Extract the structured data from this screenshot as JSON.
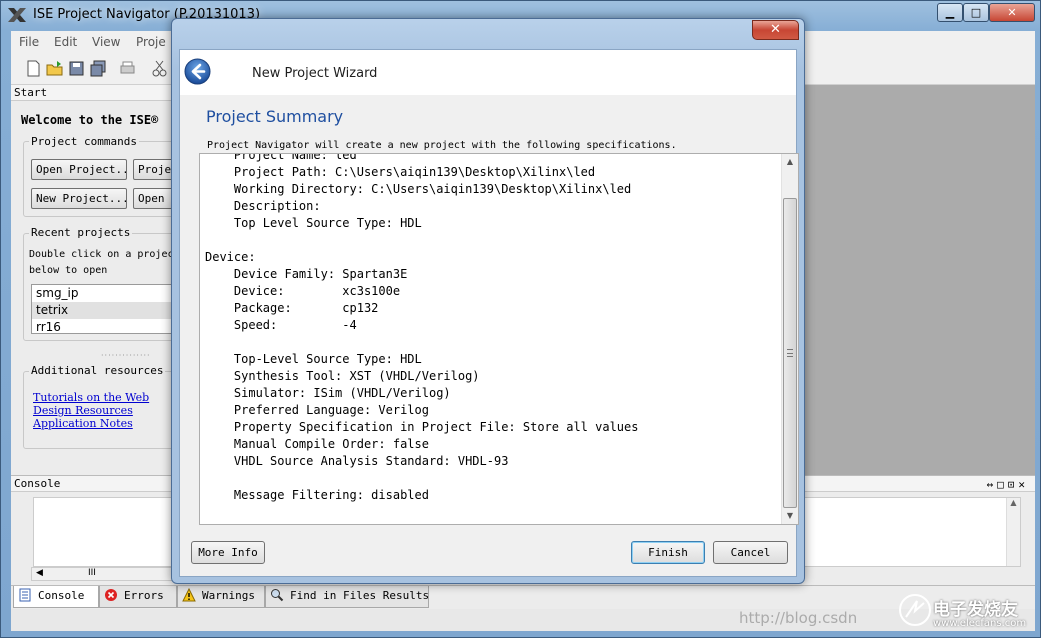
{
  "window": {
    "title": "ISE Project Navigator (P.20131013)",
    "minimize_glyph": "▁",
    "maximize_glyph": "□",
    "close_glyph": "✕"
  },
  "menu": [
    "File",
    "Edit",
    "View",
    "Proje"
  ],
  "start_panel": {
    "header": "Start",
    "welcome": "Welcome to the ISE®",
    "project_commands_label": "Project commands",
    "open_project": "Open Project...",
    "project_browser": "Proje",
    "new_project": "New Project...",
    "open_example": "Open",
    "recent_label": "Recent projects",
    "recent_hint_1": "Double click on a projec",
    "recent_hint_2": "below to open",
    "recent_items": [
      "smg_ip",
      "tetrix",
      "rr16"
    ],
    "additional_label": "Additional resources",
    "links": [
      "Tutorials on the Web",
      "Design Resources",
      "Application Notes"
    ]
  },
  "console": {
    "header": "Console",
    "hscroll_grip": "III",
    "tabs": [
      {
        "label": "Console",
        "icon": "console-icon"
      },
      {
        "label": "Errors",
        "icon": "error-icon"
      },
      {
        "label": "Warnings",
        "icon": "warning-icon"
      },
      {
        "label": "Find in Files Results",
        "icon": "find-icon"
      }
    ]
  },
  "watermark": "http://blog.csdn",
  "brand": {
    "name": "电子发烧友",
    "url": "www.elecfans.com"
  },
  "wizard": {
    "title": "New Project Wizard",
    "close_glyph": "✕",
    "heading": "Project Summary",
    "description": "Project Navigator will create a new project with the following specifications.",
    "summary_lines": [
      "    Project Name: led",
      "    Project Path: C:\\Users\\aiqin139\\Desktop\\Xilinx\\led",
      "    Working Directory: C:\\Users\\aiqin139\\Desktop\\Xilinx\\led",
      "    Description:",
      "    Top Level Source Type: HDL",
      "",
      "Device:",
      "    Device Family: Spartan3E",
      "    Device:        xc3s100e",
      "    Package:       cp132",
      "    Speed:         -4",
      "",
      "    Top-Level Source Type: HDL",
      "    Synthesis Tool: XST (VHDL/Verilog)",
      "    Simulator: ISim (VHDL/Verilog)",
      "    Preferred Language: Verilog",
      "    Property Specification in Project File: Store all values",
      "    Manual Compile Order: false",
      "    VHDL Source Analysis Standard: VHDL-93",
      "",
      "    Message Filtering: disabled"
    ],
    "buttons": {
      "more_info": "More Info",
      "finish": "Finish",
      "cancel": "Cancel"
    }
  },
  "colors": {
    "heading_blue": "#1f4fa0",
    "link_blue": "#0000d0",
    "close_red": "#c74634"
  }
}
